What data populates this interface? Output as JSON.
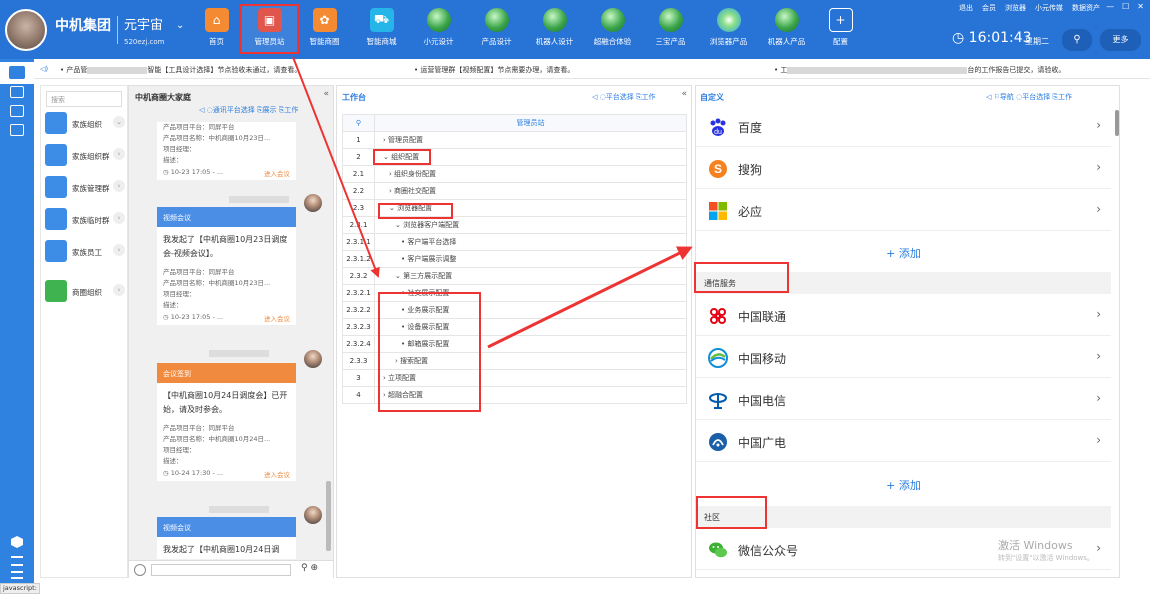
{
  "header": {
    "brand": "中机集团",
    "workspace_name": "元宇宙",
    "workspace_url": "520ezj.com",
    "nav": [
      {
        "label": "首页",
        "icon": "home-icon"
      },
      {
        "label": "管理员站",
        "icon": "admin-icon"
      },
      {
        "label": "智能商圈",
        "icon": "gear-icon"
      },
      {
        "label": "智能商城",
        "icon": "cart-icon"
      },
      {
        "label": "小元设计",
        "icon": "globe-icon"
      },
      {
        "label": "产品设计",
        "icon": "globe-icon"
      },
      {
        "label": "机器人设计",
        "icon": "globe-icon"
      },
      {
        "label": "超融合体验",
        "icon": "globe-icon"
      },
      {
        "label": "三宝产品",
        "icon": "globe-icon"
      },
      {
        "label": "浏览器产品",
        "icon": "browser-icon"
      },
      {
        "label": "机器人产品",
        "icon": "globe-icon"
      },
      {
        "label": "配置",
        "icon": "plus-icon"
      }
    ],
    "top_links": [
      "退出",
      "会员",
      "浏览器",
      "小元传媒",
      "数据资产"
    ],
    "clock": "16:01:43",
    "weekday": "星期二",
    "search_glyph": "⚲",
    "more": "更多"
  },
  "ticker": [
    "• 产品管",
    "智能【工具设计选择】节点验收未通过，请查看。",
    "• 运营管理群【视频配置】节点需要办理，请查看。",
    "• 工",
    "台的工作报告已提交，请验收。"
  ],
  "org": {
    "search_placeholder": "搜索",
    "items": [
      {
        "label": "家族组织"
      },
      {
        "label": "家族组织群"
      },
      {
        "label": "家族管理群"
      },
      {
        "label": "家族临时群"
      },
      {
        "label": "家族员工"
      },
      {
        "label": "商圈组织"
      }
    ]
  },
  "chat": {
    "title": "中机商圈大家庭",
    "tools": "◁ ◌通讯平台选择  ⎘展示  ⎘工作",
    "cards": [
      {
        "meta": [
          "产品项目平台：同屏平台",
          "产品项目名称：中机商圈10月23日...",
          "项目经理：",
          "描述："
        ],
        "time": "◷ 10-23 17:05 - ...",
        "join": "进入会议"
      },
      {
        "header": "视频会议",
        "msg": "我发起了【中机商圈10月23日调度会-视频会议】。",
        "meta": [
          "产品项目平台：同屏平台",
          "产品项目名称：中机商圈10月23日...",
          "项目经理：",
          "描述："
        ],
        "time": "◷ 10-23 17:05 - ...",
        "join": "进入会议"
      },
      {
        "header": "会议签到",
        "msg": "【中机商圈10月24日调度会】已开始，请及时参会。",
        "meta": [
          "产品项目平台：同屏平台",
          "产品项目名称：中机商圈10月24日...",
          "项目经理：",
          "描述："
        ],
        "time": "◷ 10-24 17:30 - ...",
        "join": "进入会议"
      },
      {
        "header": "视频会议",
        "msg": "我发起了【中机商圈10月24日调"
      }
    ]
  },
  "workbench": {
    "title": "工作台",
    "tools": "◁ ◌平台选择  ⎘工作",
    "column_header": "管理员站",
    "rows": [
      {
        "num": "1",
        "label": "›  管理员配置"
      },
      {
        "num": "2",
        "label": "⌄  组织配置"
      },
      {
        "num": "2.1",
        "label": "›  组织身份配置"
      },
      {
        "num": "2.2",
        "label": "›  商圈社交配置"
      },
      {
        "num": "2.3",
        "label": "⌄  浏览器配置"
      },
      {
        "num": "2.3.1",
        "label": "⌄  浏览器客户端配置"
      },
      {
        "num": "2.3.1.1",
        "label": "•    客户端平台选择"
      },
      {
        "num": "2.3.1.2",
        "label": "•    客户端展示调整"
      },
      {
        "num": "2.3.2",
        "label": "⌄  第三方展示配置"
      },
      {
        "num": "2.3.2.1",
        "label": "•    社交展示配置"
      },
      {
        "num": "2.3.2.2",
        "label": "•    业务展示配置"
      },
      {
        "num": "2.3.2.3",
        "label": "•    设备展示配置"
      },
      {
        "num": "2.3.2.4",
        "label": "•    邮箱展示配置"
      },
      {
        "num": "2.3.3",
        "label": "›  搜索配置"
      },
      {
        "num": "3",
        "label": "›  立项配置"
      },
      {
        "num": "4",
        "label": "›  超融合配置"
      }
    ]
  },
  "custom": {
    "title": "自定义",
    "tools": "◁ ⚐导航  ◌平台选择  ⎘工作",
    "search_engines": [
      {
        "label": "百度",
        "icon": "baidu-icon"
      },
      {
        "label": "搜狗",
        "icon": "sogou-icon"
      },
      {
        "label": "必应",
        "icon": "bing-icon"
      }
    ],
    "add_label": "+ 添加",
    "telecom_section": "通信服务",
    "telecom": [
      {
        "label": "中国联通",
        "icon": "unicom-icon"
      },
      {
        "label": "中国移动",
        "icon": "mobile-icon"
      },
      {
        "label": "中国电信",
        "icon": "telecom-icon"
      },
      {
        "label": "中国广电",
        "icon": "broadcast-icon"
      }
    ],
    "social_section": "社区",
    "social": [
      {
        "label": "微信公众号",
        "icon": "wechat-icon"
      }
    ]
  },
  "watermark": {
    "line1": "激活 Windows",
    "line2": "转到\"设置\"以激活 Windows。"
  },
  "status_text": "javascript:",
  "colors": {
    "topbar": "#2873d6",
    "accent": "#2a7ce0",
    "highlight": "#e33333"
  }
}
